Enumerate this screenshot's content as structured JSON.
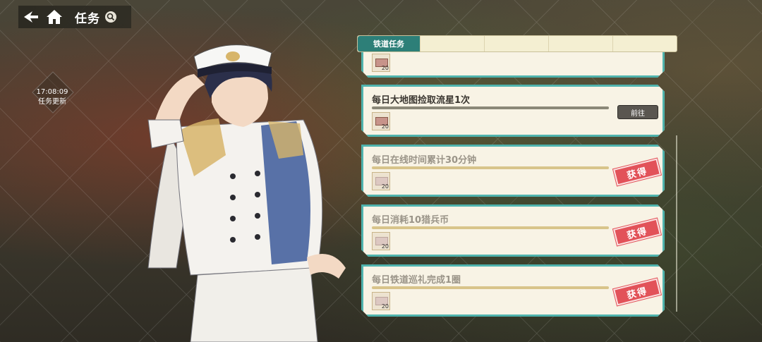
{
  "header": {
    "title": "任务"
  },
  "refresh": {
    "time": "17:08:09",
    "label": "任务更新"
  },
  "tabs": {
    "active_label": "铁道任务"
  },
  "tasks": [
    {
      "title": "",
      "status": "partial",
      "reward_qty": "20"
    },
    {
      "title": "每日大地图捡取流星1次",
      "status": "in_progress",
      "reward_qty": "20",
      "button_label": "前往"
    },
    {
      "title": "每日在线时间累计30分钟",
      "status": "claimed",
      "reward_qty": "20",
      "stamp_label": "获得"
    },
    {
      "title": "每日消耗10猎兵币",
      "status": "claimed",
      "reward_qty": "20",
      "stamp_label": "获得"
    },
    {
      "title": "每日铁道巡礼完成1圈",
      "status": "claimed",
      "reward_qty": "20",
      "stamp_label": "获得"
    }
  ],
  "colors": {
    "accent": "#4fb3ad",
    "tab_active": "#2d7f78",
    "stamp": "#e25259",
    "card_bg": "#f8f3e5"
  },
  "icons": [
    "back-icon",
    "home-icon",
    "search-icon",
    "ticket-icon"
  ]
}
